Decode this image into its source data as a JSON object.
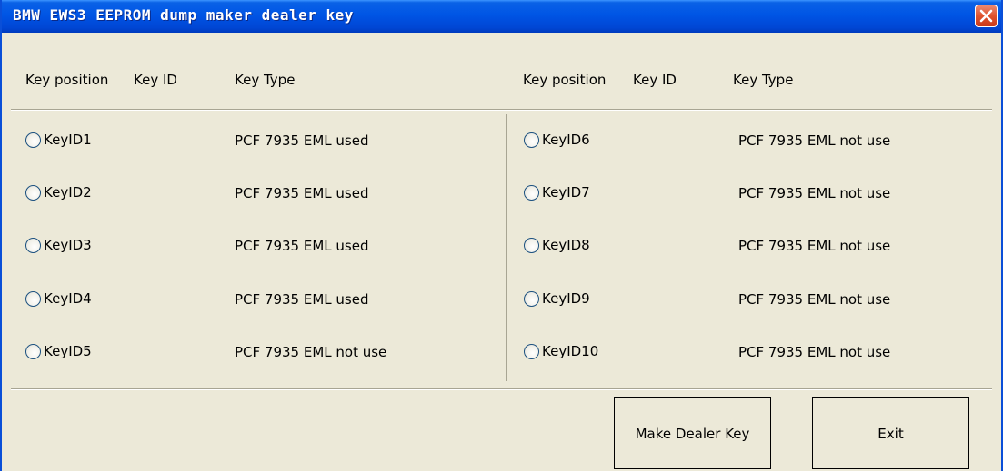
{
  "window": {
    "title": "BMW EWS3 EEPROM dump maker dealer key"
  },
  "headers": {
    "left": {
      "key_position": "Key position",
      "key_id": "Key ID",
      "key_type": "Key Type"
    },
    "right": {
      "key_position": "Key position",
      "key_id": "Key ID",
      "key_type": "Key Type"
    }
  },
  "keys_left": [
    {
      "label": "KeyID1",
      "type": "PCF 7935 EML used"
    },
    {
      "label": "KeyID2",
      "type": "PCF 7935 EML used"
    },
    {
      "label": "KeyID3",
      "type": "PCF 7935 EML used"
    },
    {
      "label": "KeyID4",
      "type": "PCF 7935 EML used"
    },
    {
      "label": "KeyID5",
      "type": "PCF 7935 EML not use"
    }
  ],
  "keys_right": [
    {
      "label": "KeyID6",
      "type": "PCF 7935 EML not use"
    },
    {
      "label": "KeyID7",
      "type": "PCF 7935 EML not use"
    },
    {
      "label": "KeyID8",
      "type": "PCF 7935 EML not use"
    },
    {
      "label": "KeyID9",
      "type": "PCF 7935 EML not use"
    },
    {
      "label": "KeyID10",
      "type": "PCF 7935 EML not use"
    }
  ],
  "buttons": {
    "make_dealer_key": "Make Dealer Key",
    "exit": "Exit"
  },
  "colors": {
    "title_bar": "#0055e5",
    "window_bg": "#ece9d8",
    "close_button": "#e0542e"
  }
}
